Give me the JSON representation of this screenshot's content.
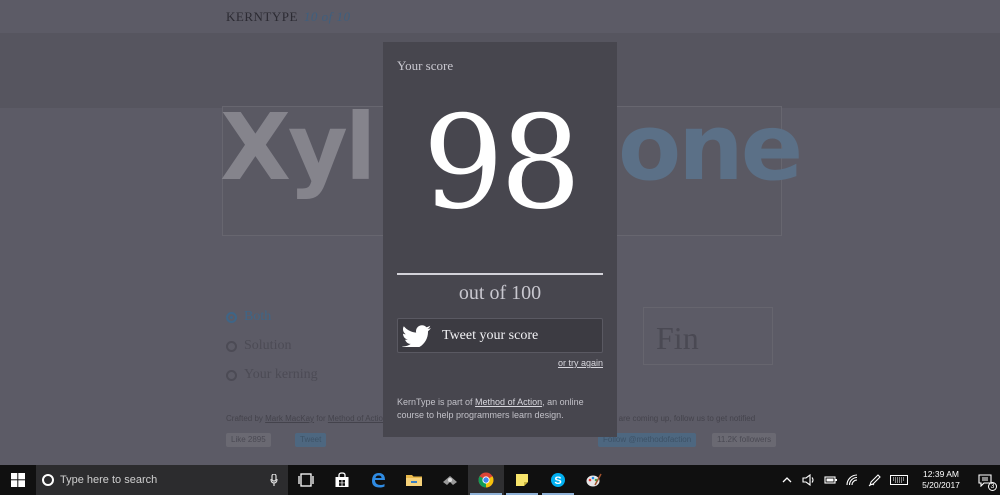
{
  "app": {
    "brand": "KERNTYPE",
    "progress": "10 of 10"
  },
  "puzzle": {
    "word_left": "Xyl",
    "word_right": "one",
    "options": [
      {
        "label": "Both",
        "selected": true
      },
      {
        "label": "Solution",
        "selected": false
      },
      {
        "label": "Your kerning",
        "selected": false
      }
    ],
    "finish_button": "Fin"
  },
  "footer": {
    "credit_prefix": "Crafted by",
    "author": "Mark MacKay",
    "credit_mid": "for",
    "org": "Method of Action",
    "notice": "Classes are coming up, follow us to get notified",
    "like_chip": "Like 2895",
    "tweet_chip": "Tweet",
    "follow_chip": "Follow @methodofaction",
    "followers_chip": "11.2K followers"
  },
  "modal": {
    "label": "Your score",
    "score": "98",
    "out_of": "out of 100",
    "tweet_button": "Tweet your score",
    "try_again": "or try again",
    "about_prefix": "KernType is part of ",
    "about_link": "Method of Action",
    "about_suffix": ", an online course to help programmers learn design."
  },
  "taskbar": {
    "search_placeholder": "Type here to search",
    "time": "12:39 AM",
    "date": "5/20/2017",
    "notification_count": "3",
    "apps": [
      "task-view",
      "store",
      "edge",
      "file-explorer",
      "app",
      "chrome",
      "sticky-notes",
      "skype",
      "paint"
    ]
  },
  "colors": {
    "modal_bg": "#47464e",
    "page_bg": "#5c5b66",
    "accent": "#3f6586"
  }
}
